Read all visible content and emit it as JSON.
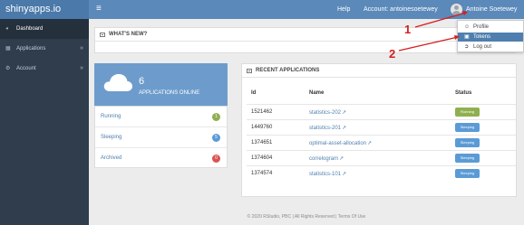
{
  "header": {
    "brand": "shinyapps.io",
    "menu_icon": "hamburger-icon",
    "help": "Help",
    "account": "Account: antoinesoetewey",
    "username": "Antoine Soetewey"
  },
  "sidebar": {
    "items": [
      {
        "label": "Dashboard",
        "icon": "dashboard-icon"
      },
      {
        "label": "Applications",
        "icon": "applications-icon"
      },
      {
        "label": "Account",
        "icon": "account-icon"
      }
    ]
  },
  "user_menu": {
    "items": [
      {
        "label": "Profile",
        "icon": "user-icon"
      },
      {
        "label": "Tokens",
        "icon": "lock-icon"
      },
      {
        "label": "Log out",
        "icon": "logout-icon"
      }
    ]
  },
  "whats_new": {
    "title": "WHAT'S NEW?"
  },
  "stats": {
    "count": "6",
    "label": "APPLICATIONS ONLINE",
    "rows": [
      {
        "label": "Running",
        "count": "1",
        "color": "#8fb04f"
      },
      {
        "label": "Sleeping",
        "count": "5",
        "color": "#5b9bd5"
      },
      {
        "label": "Archived",
        "count": "0",
        "color": "#d9534f"
      }
    ]
  },
  "recent": {
    "title": "RECENT APPLICATIONS",
    "columns": [
      "Id",
      "Name",
      "Status"
    ],
    "rows": [
      {
        "id": "1521462",
        "name": "statistics-202",
        "status": "Running"
      },
      {
        "id": "1449760",
        "name": "statistics-201",
        "status": "Sleeping"
      },
      {
        "id": "1374651",
        "name": "optimal-asset-allocation",
        "status": "Sleeping"
      },
      {
        "id": "1374604",
        "name": "correlogram",
        "status": "Sleeping"
      },
      {
        "id": "1374574",
        "name": "statistics-101",
        "status": "Sleeping"
      }
    ]
  },
  "footer": "© 2020 RStudio, PBC | All Rights Reserved | Terms Of Use",
  "annotations": {
    "one": "1",
    "two": "2",
    "color": "#d41e1e"
  },
  "colors": {
    "topbar": "#5b89b9",
    "sidebar": "#2f3d4c",
    "accent": "#4f7fae",
    "running": "#8fb04f",
    "sleeping": "#5b9bd5"
  }
}
